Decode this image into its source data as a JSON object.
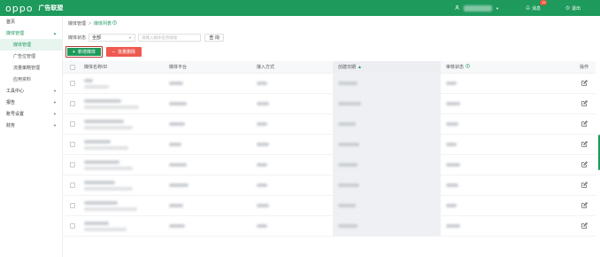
{
  "header": {
    "logo": "oppo",
    "title": "广告联盟",
    "messages_label": "消息",
    "messages_count": "15",
    "logout_label": "退出"
  },
  "sidebar": {
    "items": [
      {
        "label": "首页",
        "type": "top"
      },
      {
        "label": "媒体管理",
        "type": "group-open"
      },
      {
        "label": "媒体管理",
        "type": "sub-active"
      },
      {
        "label": "广告位管理",
        "type": "sub"
      },
      {
        "label": "流量策略管理",
        "type": "sub"
      },
      {
        "label": "应用资料",
        "type": "sub"
      },
      {
        "label": "工具中心",
        "type": "group"
      },
      {
        "label": "报告",
        "type": "group"
      },
      {
        "label": "账号设置",
        "type": "group"
      },
      {
        "label": "财务",
        "type": "group"
      }
    ]
  },
  "breadcrumb": {
    "root": "媒体管理",
    "separator": ">",
    "current": "媒体列表"
  },
  "filters": {
    "status_label": "媒体状态",
    "status_value": "全部",
    "search_placeholder": "请输入媒体名称搜索",
    "query_button": "查 询"
  },
  "actions": {
    "add_label": "新增媒体",
    "batch_delete_label": "批量删除"
  },
  "table": {
    "headers": {
      "name": "媒体名称/ID",
      "platform": "媒体平台",
      "access_mode": "接入方式",
      "created_date": "创建日期",
      "audit_status": "审核状态",
      "operation": "操作"
    },
    "row_count": 8
  },
  "colors": {
    "brand": "#1d9a5c",
    "danger": "#ee5a4f",
    "badge": "#f0533d"
  },
  "icons": {
    "user": "user-icon",
    "message": "bell-icon",
    "logout": "power-icon",
    "edit": "edit-icon"
  }
}
